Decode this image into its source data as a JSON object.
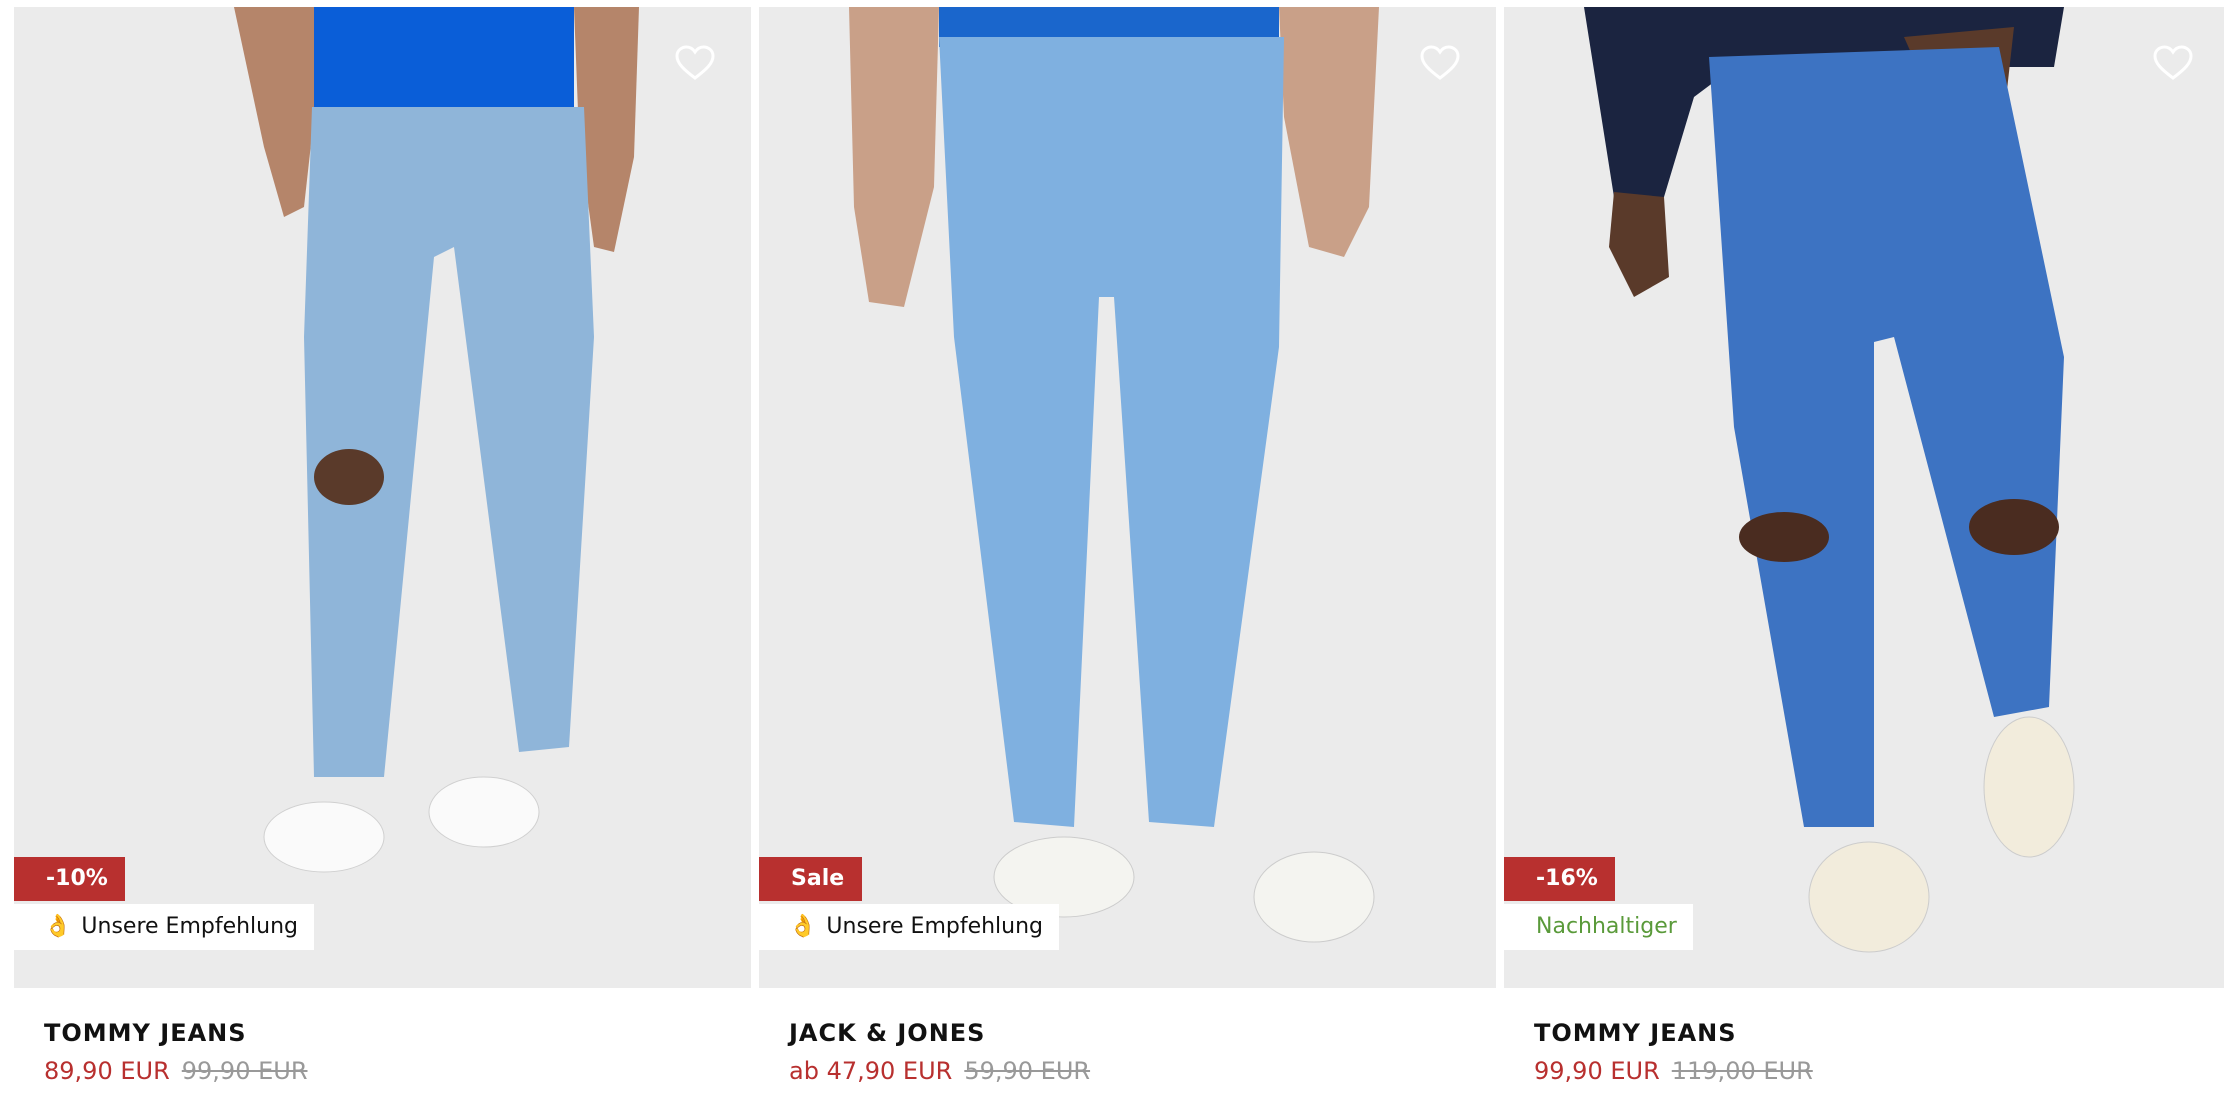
{
  "products": [
    {
      "brand": "TOMMY JEANS",
      "price": "89,90 EUR",
      "old_price": "99,90 EUR",
      "discount_badge": "-10%",
      "tag": "Unsere Empfehlung",
      "tag_emoji": "👌",
      "jeans_color": "#8fb5d9",
      "shirt_color": "#0a5ed8"
    },
    {
      "brand": "JACK & JONES",
      "price": "ab 47,90 EUR",
      "old_price": "59,90 EUR",
      "discount_badge": "Sale",
      "tag": "Unsere Empfehlung",
      "tag_emoji": "👌",
      "jeans_color": "#7fb0e0",
      "shirt_color": "#1a66cc"
    },
    {
      "brand": "TOMMY JEANS",
      "price": "99,90 EUR",
      "old_price": "119,00 EUR",
      "discount_badge": "-16%",
      "tag": "Nachhaltiger",
      "tag_emoji": "",
      "jeans_color": "#3d73c2",
      "shirt_color": "#1b2440"
    }
  ],
  "icons": {
    "wishlist": "heart-outline-icon"
  },
  "colors": {
    "sale_red": "#b8302f",
    "sustainable_green": "#5a9a3a",
    "image_bg": "#ebebeb"
  }
}
